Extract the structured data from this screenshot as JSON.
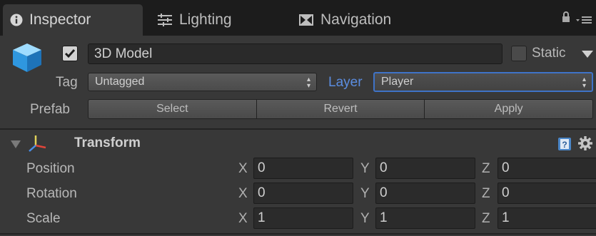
{
  "tabs": [
    {
      "label": "Inspector",
      "icon": "info-icon",
      "active": true
    },
    {
      "label": "Lighting",
      "icon": "sliders-icon",
      "active": false
    },
    {
      "label": "Navigation",
      "icon": "navigation-icon",
      "active": false
    }
  ],
  "window_icons": [
    "lock-icon",
    "menu-icon"
  ],
  "object": {
    "icon": "cube-icon",
    "active": true,
    "name": "3D Model",
    "static_label": "Static",
    "static_checked": false
  },
  "tag": {
    "label": "Tag",
    "value": "Untagged"
  },
  "layer": {
    "label": "Layer",
    "value": "Player"
  },
  "prefab": {
    "label": "Prefab",
    "buttons": [
      "Select",
      "Revert",
      "Apply"
    ]
  },
  "transform": {
    "title": "Transform",
    "rows": [
      {
        "label": "Position",
        "x": "0",
        "y": "0",
        "z": "0"
      },
      {
        "label": "Rotation",
        "x": "0",
        "y": "0",
        "z": "0"
      },
      {
        "label": "Scale",
        "x": "1",
        "y": "1",
        "z": "1"
      }
    ],
    "axes": [
      "X",
      "Y",
      "Z"
    ]
  },
  "colors": {
    "background": "#383838",
    "tabbar": "#1c1c1c",
    "layer_label": "#5b8de0",
    "focus_border": "#3f73c7"
  }
}
